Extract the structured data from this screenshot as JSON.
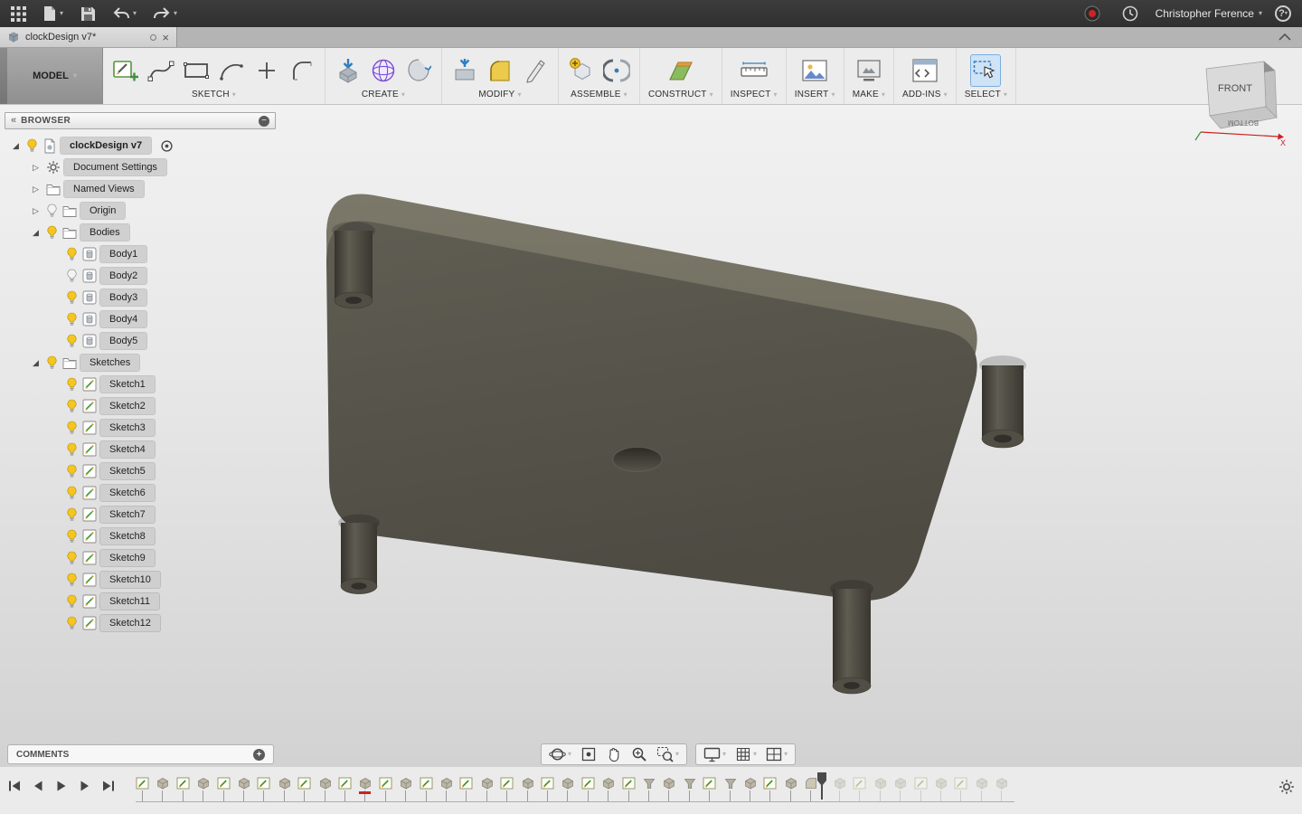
{
  "topbar": {
    "user": "Christopher Ference"
  },
  "tabbar": {
    "document_title": "clockDesign v7*"
  },
  "ribbon": {
    "workspace": "MODEL",
    "groups": [
      {
        "label": "SKETCH",
        "icons": [
          "create-sketch",
          "spline",
          "rectangle",
          "arc",
          "point",
          "fillet-sk"
        ],
        "active": false
      },
      {
        "label": "CREATE",
        "icons": [
          "extrude",
          "form",
          "revolve"
        ],
        "active": false
      },
      {
        "label": "MODIFY",
        "icons": [
          "press-pull",
          "fillet",
          "modify-edit"
        ],
        "active": false
      },
      {
        "label": "ASSEMBLE",
        "icons": [
          "new-component",
          "joint"
        ],
        "active": false
      },
      {
        "label": "CONSTRUCT",
        "icons": [
          "construct-plane"
        ],
        "active": false
      },
      {
        "label": "INSPECT",
        "icons": [
          "measure"
        ],
        "active": false
      },
      {
        "label": "INSERT",
        "icons": [
          "insert-image"
        ],
        "active": false
      },
      {
        "label": "MAKE",
        "icons": [
          "make"
        ],
        "active": false
      },
      {
        "label": "ADD-INS",
        "icons": [
          "addins"
        ],
        "active": false
      },
      {
        "label": "SELECT",
        "icons": [
          "select"
        ],
        "active": true
      }
    ]
  },
  "viewcube": {
    "front_label": "FRONT",
    "bottom_label": "BOTTOM",
    "axis_x": "X"
  },
  "browser": {
    "title": "BROWSER",
    "tree": [
      {
        "label": "clockDesign v7",
        "level": 0,
        "expand": "expanded",
        "bulb": "on",
        "icon": "doc",
        "root": true,
        "trail": "target"
      },
      {
        "label": "Document Settings",
        "level": 1,
        "expand": "collapsed",
        "icon": "gear"
      },
      {
        "label": "Named Views",
        "level": 1,
        "expand": "collapsed",
        "icon": "folder"
      },
      {
        "label": "Origin",
        "level": 1,
        "expand": "collapsed",
        "bulb": "off",
        "icon": "folder"
      },
      {
        "label": "Bodies",
        "level": 1,
        "expand": "expanded",
        "bulb": "on",
        "icon": "folder"
      },
      {
        "label": "Body1",
        "level": 2,
        "bulb": "on",
        "icon": "body"
      },
      {
        "label": "Body2",
        "level": 2,
        "bulb": "off",
        "icon": "body"
      },
      {
        "label": "Body3",
        "level": 2,
        "bulb": "on",
        "icon": "body"
      },
      {
        "label": "Body4",
        "level": 2,
        "bulb": "on",
        "icon": "body"
      },
      {
        "label": "Body5",
        "level": 2,
        "bulb": "on",
        "icon": "body"
      },
      {
        "label": "Sketches",
        "level": 1,
        "expand": "expanded",
        "bulb": "on",
        "icon": "folder"
      },
      {
        "label": "Sketch1",
        "level": 2,
        "bulb": "on",
        "icon": "sketch"
      },
      {
        "label": "Sketch2",
        "level": 2,
        "bulb": "on",
        "icon": "sketch"
      },
      {
        "label": "Sketch3",
        "level": 2,
        "bulb": "on",
        "icon": "sketch"
      },
      {
        "label": "Sketch4",
        "level": 2,
        "bulb": "on",
        "icon": "sketch"
      },
      {
        "label": "Sketch5",
        "level": 2,
        "bulb": "on",
        "icon": "sketch"
      },
      {
        "label": "Sketch6",
        "level": 2,
        "bulb": "on",
        "icon": "sketch"
      },
      {
        "label": "Sketch7",
        "level": 2,
        "bulb": "on",
        "icon": "sketch"
      },
      {
        "label": "Sketch8",
        "level": 2,
        "bulb": "on",
        "icon": "sketch"
      },
      {
        "label": "Sketch9",
        "level": 2,
        "bulb": "on",
        "icon": "sketch"
      },
      {
        "label": "Sketch10",
        "level": 2,
        "bulb": "on",
        "icon": "sketch"
      },
      {
        "label": "Sketch11",
        "level": 2,
        "bulb": "on",
        "icon": "sketch"
      },
      {
        "label": "Sketch12",
        "level": 2,
        "bulb": "on",
        "icon": "sketch"
      }
    ]
  },
  "comments": {
    "label": "COMMENTS"
  },
  "navbar": {
    "buttons": [
      {
        "name": "orbit",
        "caret": true
      },
      {
        "name": "look-at",
        "caret": false
      },
      {
        "name": "pan",
        "caret": false
      },
      {
        "name": "zoom",
        "caret": false
      },
      {
        "name": "zoom-window",
        "caret": true
      },
      {
        "name": "display-settings",
        "caret": true
      },
      {
        "name": "grid-display",
        "caret": true
      },
      {
        "name": "viewports",
        "caret": true
      }
    ]
  },
  "timeline": {
    "playback": [
      "go-to-start",
      "step-back",
      "play",
      "step-forward",
      "go-to-end"
    ],
    "markers": [
      {
        "type": "sketch",
        "state": "done"
      },
      {
        "type": "extrude",
        "state": "done"
      },
      {
        "type": "sketch",
        "state": "done"
      },
      {
        "type": "extrude",
        "state": "done"
      },
      {
        "type": "sketch",
        "state": "done"
      },
      {
        "type": "extrude",
        "state": "done"
      },
      {
        "type": "sketch",
        "state": "done"
      },
      {
        "type": "extrude",
        "state": "done"
      },
      {
        "type": "sketch",
        "state": "done"
      },
      {
        "type": "extrude",
        "state": "done"
      },
      {
        "type": "sketch",
        "state": "done"
      },
      {
        "type": "extrude",
        "state": "done",
        "error": true
      },
      {
        "type": "sketch",
        "state": "done"
      },
      {
        "type": "extrude",
        "state": "done"
      },
      {
        "type": "sketch",
        "state": "done"
      },
      {
        "type": "extrude",
        "state": "done"
      },
      {
        "type": "sketch",
        "state": "done"
      },
      {
        "type": "extrude",
        "state": "done"
      },
      {
        "type": "sketch",
        "state": "done"
      },
      {
        "type": "extrude",
        "state": "done"
      },
      {
        "type": "sketch",
        "state": "done"
      },
      {
        "type": "extrude",
        "state": "done"
      },
      {
        "type": "sketch",
        "state": "done"
      },
      {
        "type": "extrude",
        "state": "done"
      },
      {
        "type": "sketch",
        "state": "done"
      },
      {
        "type": "hole",
        "state": "done"
      },
      {
        "type": "extrude",
        "state": "done"
      },
      {
        "type": "hole",
        "state": "done"
      },
      {
        "type": "sketch",
        "state": "done"
      },
      {
        "type": "hole",
        "state": "done"
      },
      {
        "type": "extrude",
        "state": "done"
      },
      {
        "type": "sketch",
        "state": "done"
      },
      {
        "type": "extrude",
        "state": "done"
      },
      {
        "type": "fillet",
        "state": "done"
      },
      {
        "type": "extrude",
        "state": "future"
      },
      {
        "type": "sketch",
        "state": "future"
      },
      {
        "type": "extrude",
        "state": "future"
      },
      {
        "type": "extrude",
        "state": "future"
      },
      {
        "type": "sketch",
        "state": "future"
      },
      {
        "type": "extrude",
        "state": "future"
      },
      {
        "type": "sketch",
        "state": "future"
      },
      {
        "type": "extrude",
        "state": "future"
      },
      {
        "type": "extrude",
        "state": "future"
      }
    ]
  }
}
